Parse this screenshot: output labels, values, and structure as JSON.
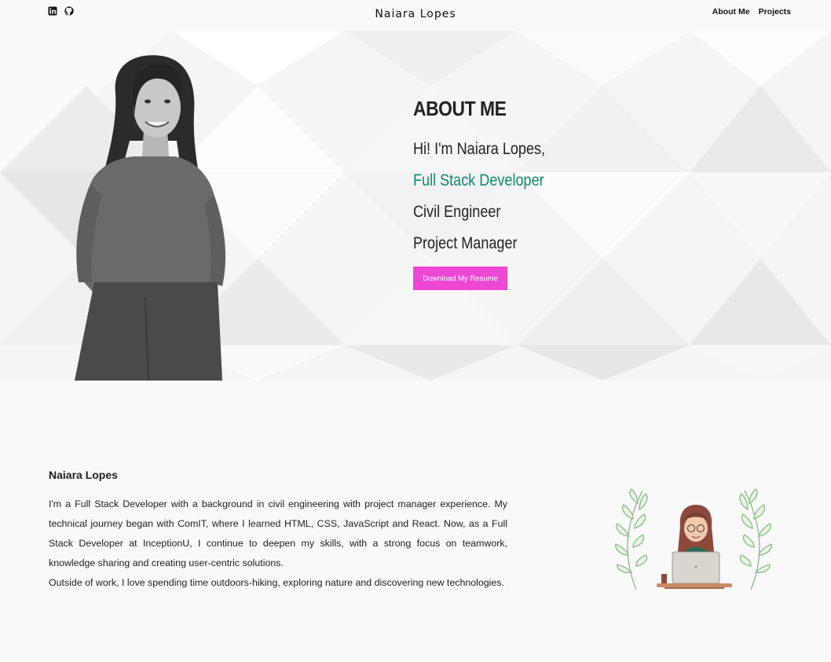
{
  "header": {
    "brand": "Naiara Lopes",
    "social": [
      "linkedin-icon",
      "github-icon"
    ],
    "nav": [
      "About Me",
      "Projects"
    ]
  },
  "hero": {
    "heading": "ABOUT ME",
    "greeting": "Hi! I'm Naiara Lopes,",
    "roles": [
      "Full Stack Developer",
      "Civil Engineer",
      "Project Manager"
    ],
    "button": "Download My Resume"
  },
  "bio": {
    "name": "Naiara Lopes",
    "paragraph1": "I'm a Full Stack Developer with a background in civil engineering with project manager experience. My technical journey began with ComIT, where I learned HTML, CSS, JavaScript and React. Now, as a Full Stack Developer at InceptionU, I continue to deepen my skills, with a strong focus on teamwork, knowledge sharing and creating user-centric solutions.",
    "paragraph2": "Outside of work, I love spending time outdoors-hiking, exploring nature and discovering new technologies."
  },
  "colors": {
    "accent": "#0f8a6c",
    "button": "#ec48d4",
    "background": "#f9f9f9"
  }
}
